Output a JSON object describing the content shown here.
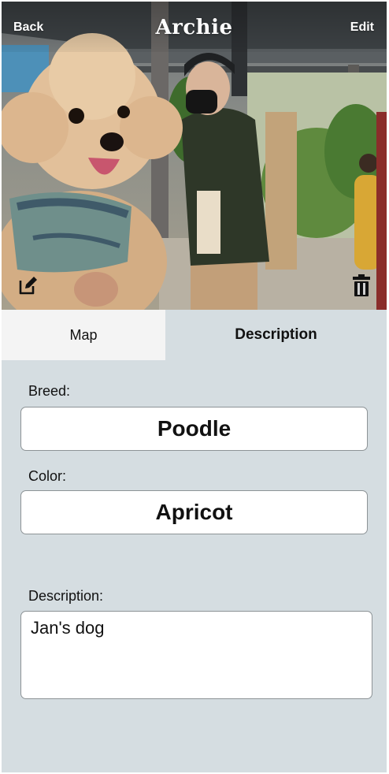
{
  "header": {
    "back_label": "Back",
    "title": "Archie",
    "edit_label": "Edit"
  },
  "tabs": [
    {
      "label": "Map",
      "active": false
    },
    {
      "label": "Description",
      "active": true
    }
  ],
  "fields": {
    "breed": {
      "label": "Breed:",
      "value": "Poodle"
    },
    "color": {
      "label": "Color:",
      "value": "Apricot"
    },
    "description": {
      "label": "Description:",
      "value": "Jan's dog"
    }
  },
  "icons": {
    "photo_edit": "edit-square-icon",
    "delete": "trash-icon"
  },
  "colors": {
    "background": "#d5dde1",
    "inactive_tab": "#f4f4f4",
    "field_border": "#8d9396"
  }
}
